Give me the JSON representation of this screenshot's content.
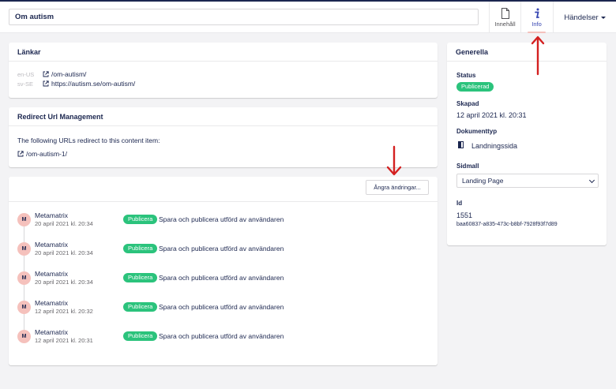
{
  "header": {
    "node_name": "Om autism",
    "apps": [
      {
        "label": "Innehåll",
        "icon": "document-icon"
      },
      {
        "label": "Info",
        "icon": "info-icon"
      }
    ],
    "events_label": "Händelser"
  },
  "links": {
    "title": "Länkar",
    "items": [
      {
        "lang": "en-US",
        "url": "/om-autism/"
      },
      {
        "lang": "sv-SE",
        "url": "https://autism.se/om-autism/"
      }
    ]
  },
  "redirects": {
    "title": "Redirect Url Management",
    "description": "The following URLs redirect to this content item:",
    "items": [
      "/om-autism-1/"
    ]
  },
  "history": {
    "undo_label": "Ångra ändringar...",
    "items": [
      {
        "initial": "M",
        "user": "Metamatrix",
        "date": "20 april 2021 kl. 20:34",
        "badge": "Publicera",
        "text": "Spara och publicera utförd av användaren"
      },
      {
        "initial": "M",
        "user": "Metamatrix",
        "date": "20 april 2021 kl. 20:34",
        "badge": "Publicera",
        "text": "Spara och publicera utförd av användaren"
      },
      {
        "initial": "M",
        "user": "Metamatrix",
        "date": "20 april 2021 kl. 20:34",
        "badge": "Publicera",
        "text": "Spara och publicera utförd av användaren"
      },
      {
        "initial": "M",
        "user": "Metamatrix",
        "date": "12 april 2021 kl. 20:32",
        "badge": "Publicera",
        "text": "Spara och publicera utförd av användaren"
      },
      {
        "initial": "M",
        "user": "Metamatrix",
        "date": "12 april 2021 kl. 20:31",
        "badge": "Publicera",
        "text": "Spara och publicera utförd av användaren"
      }
    ]
  },
  "general": {
    "title": "Generella",
    "status_label": "Status",
    "status_value": "Publicerad",
    "created_label": "Skapad",
    "created_value": "12 april 2021 kl. 20:31",
    "doctype_label": "Dokumenttyp",
    "doctype_value": "Landningssida",
    "template_label": "Sidmall",
    "template_value": "Landing Page",
    "id_label": "Id",
    "id_value": "1551",
    "guid_value": "baa60837-a835-473c-b8bf-7928f93f7d89"
  },
  "colors": {
    "brand": "#1b264f",
    "publish_green": "#2bc37c",
    "avatar_pink": "#f5c1bc",
    "annotation_red": "#d42020"
  }
}
